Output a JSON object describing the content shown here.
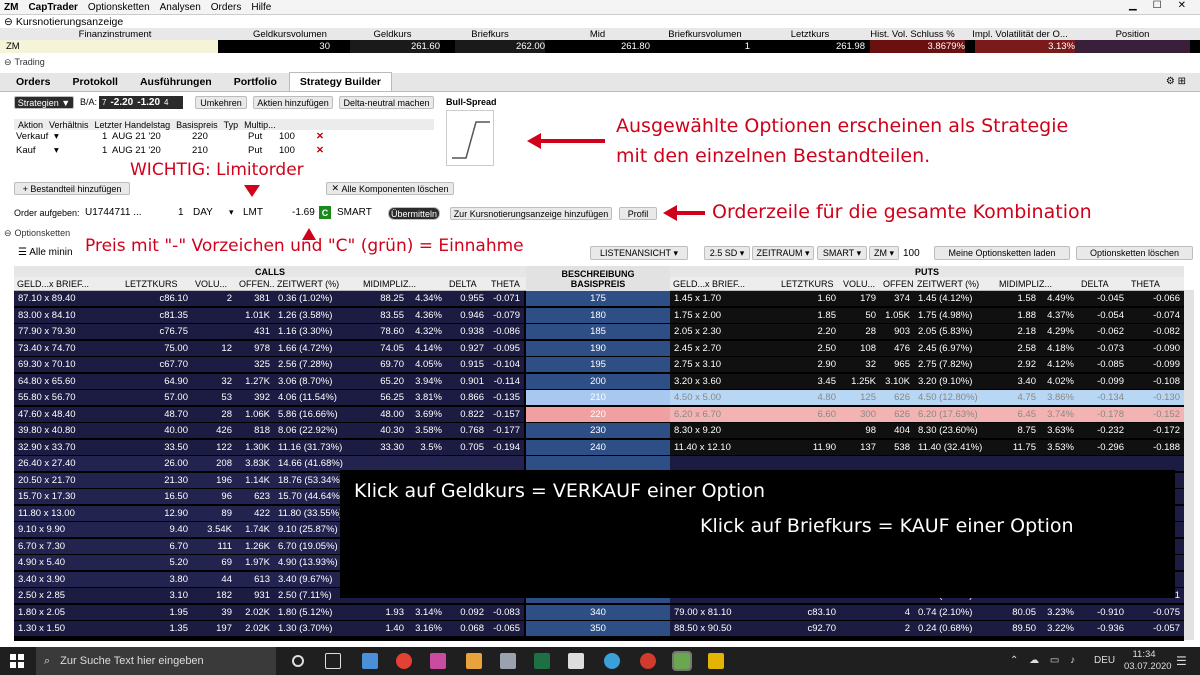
{
  "menubar": {
    "symbol": "ZM",
    "app": "CapTrader",
    "items": [
      "Optionsketten",
      "Analysen",
      "Orders",
      "Hilfe"
    ]
  },
  "kurs": {
    "title": "Kursnotierungsanzeige"
  },
  "quote": {
    "headers": [
      "Finanzinstrument",
      "Geldkursvolumen",
      "Geldkurs",
      "Briefkurs",
      "Mid",
      "Briefkursvolumen",
      "Letztkurs",
      "Hist. Vol. Schluss %",
      "Impl. Volatilität der O...",
      "Position"
    ],
    "values": [
      "ZM",
      "30",
      "261.60",
      "262.00",
      "261.80",
      "1",
      "261.98",
      "3.8679%",
      "3.13%",
      ""
    ]
  },
  "sections": {
    "trading": "Trading",
    "optionsketten": "Optionsketten"
  },
  "tabs": [
    "Orders",
    "Protokoll",
    "Ausführungen",
    "Portfolio",
    "Strategy Builder"
  ],
  "strategy": {
    "strategien": "Strategien",
    "ba_label": "B/A:",
    "ba_qty": "7",
    "bid": "-2.20",
    "ask": "-1.20",
    "ba_qty2": "4",
    "buttons": [
      "Umkehren",
      "Aktien hinzufügen",
      "Delta-neutral machen"
    ],
    "payoff_title": "Bull-Spread",
    "leg_headers": [
      "Aktion",
      "Verhältnis",
      "Letzter Handelstag",
      "Basispreis",
      "Typ",
      "Multip..."
    ],
    "legs": [
      {
        "aktion": "Verkauf",
        "ratio": "1",
        "expiry": "AUG 21 '20",
        "strike": "220",
        "typ": "Put",
        "mult": "100"
      },
      {
        "aktion": "Kauf",
        "ratio": "1",
        "expiry": "AUG 21 '20",
        "strike": "210",
        "typ": "Put",
        "mult": "100"
      }
    ],
    "add_leg": "Bestandteil hinzufügen",
    "clear_all": "Alle Komponenten löschen"
  },
  "order": {
    "label": "Order aufgeben:",
    "account": "U1744711 ...",
    "qty": "1",
    "tif": "DAY",
    "type": "LMT",
    "price": "-1.69",
    "c": "C",
    "exchange": "SMART",
    "btn_send": "Übermitteln",
    "btn_add": "Zur Kursnotierungsanzeige hinzufügen",
    "btn_profil": "Profil"
  },
  "chain_toolbar": {
    "alle": "Alle minin",
    "listview": "LISTENANSICHT",
    "sd": "2.5 SD",
    "zeitraum": "ZEITRAUM",
    "smart": "SMART",
    "zm": "ZM",
    "count": "100",
    "load": "Meine Optionsketten laden",
    "clear": "Optionsketten löschen"
  },
  "annotations": {
    "a1_line1": "Ausgewählte Optionen erscheinen als Strategie",
    "a1_line2": "mit den einzelnen Bestandteilen.",
    "wichtig": "WICHTIG: Limitorder",
    "a2": "Orderzeile für die gesamte Kombination",
    "preis": "Preis mit \"-\" Vorzeichen und \"C\" (grün) = Einnahme",
    "klick_geld": "Klick auf Geldkurs = VERKAUF einer Option",
    "klick_brief": "Klick auf Briefkurs = KAUF einer Option"
  },
  "table": {
    "calls_label": "CALLS",
    "puts_label": "PUTS",
    "strike_label_1": "BESCHREIBUNG",
    "strike_label_2": "BASISPREIS",
    "call_headers": [
      "GELD...x BRIEF...",
      "LETZTKURS",
      "VOLU...",
      "OFFEN...",
      "ZEITWERT (%)",
      "MIDIMPLIZ...",
      "DELTA",
      "THETA"
    ],
    "put_headers": [
      "GELD...x BRIEF...",
      "LETZTKURS",
      "VOLU...",
      "OFFEN...",
      "ZEITWERT (%)",
      "MIDIMPLIZ...",
      "DELTA",
      "THETA"
    ],
    "rows": [
      {
        "strike": "175",
        "c": [
          "87.10 x 89.40",
          "c86.10",
          "2",
          "381",
          "0.36 (1.02%)",
          "88.25",
          "4.34%",
          "0.955",
          "-0.071"
        ],
        "p": [
          "1.45 x 1.70",
          "1.60",
          "179",
          "374",
          "1.45 (4.12%)",
          "1.58",
          "4.49%",
          "-0.045",
          "-0.066"
        ]
      },
      {
        "strike": "180",
        "c": [
          "83.00 x 84.10",
          "c81.35",
          "",
          "1.01K",
          "1.26 (3.58%)",
          "83.55",
          "4.36%",
          "0.946",
          "-0.079"
        ],
        "p": [
          "1.75 x 2.00",
          "1.85",
          "50",
          "1.05K",
          "1.75 (4.98%)",
          "1.88",
          "4.37%",
          "-0.054",
          "-0.074"
        ]
      },
      {
        "strike": "185",
        "c": [
          "77.90 x 79.30",
          "c76.75",
          "",
          "431",
          "1.16 (3.30%)",
          "78.60",
          "4.32%",
          "0.938",
          "-0.086"
        ],
        "p": [
          "2.05 x 2.30",
          "2.20",
          "28",
          "903",
          "2.05 (5.83%)",
          "2.18",
          "4.29%",
          "-0.062",
          "-0.082"
        ]
      },
      {
        "strike": "190",
        "c": [
          "73.40 x 74.70",
          "75.00",
          "12",
          "978",
          "1.66 (4.72%)",
          "74.05",
          "4.14%",
          "0.927",
          "-0.095"
        ],
        "p": [
          "2.45 x 2.70",
          "2.50",
          "108",
          "476",
          "2.45 (6.97%)",
          "2.58",
          "4.18%",
          "-0.073",
          "-0.090"
        ]
      },
      {
        "strike": "195",
        "c": [
          "69.30 x 70.10",
          "c67.70",
          "",
          "325",
          "2.56 (7.28%)",
          "69.70",
          "4.05%",
          "0.915",
          "-0.104"
        ],
        "p": [
          "2.75 x 3.10",
          "2.90",
          "32",
          "965",
          "2.75 (7.82%)",
          "2.92",
          "4.12%",
          "-0.085",
          "-0.099"
        ]
      },
      {
        "strike": "200",
        "c": [
          "64.80 x 65.60",
          "64.90",
          "32",
          "1.27K",
          "3.06 (8.70%)",
          "65.20",
          "3.94%",
          "0.901",
          "-0.114"
        ],
        "p": [
          "3.20 x 3.60",
          "3.45",
          "1.25K",
          "3.10K",
          "3.20 (9.10%)",
          "3.40",
          "4.02%",
          "-0.099",
          "-0.108"
        ]
      },
      {
        "strike": "210",
        "c": [
          "55.80 x 56.70",
          "57.00",
          "53",
          "392",
          "4.06 (11.54%)",
          "56.25",
          "3.81%",
          "0.866",
          "-0.135"
        ],
        "p": [
          "4.50 x 5.00",
          "4.80",
          "125",
          "626",
          "4.50 (12.80%)",
          "4.75",
          "3.86%",
          "-0.134",
          "-0.130"
        ]
      },
      {
        "strike": "220",
        "c": [
          "47.60 x 48.40",
          "48.70",
          "28",
          "1.06K",
          "5.86 (16.66%)",
          "48.00",
          "3.69%",
          "0.822",
          "-0.157"
        ],
        "p": [
          "6.20 x 6.70",
          "6.60",
          "300",
          "626",
          "6.20 (17.63%)",
          "6.45",
          "3.74%",
          "-0.178",
          "-0.152"
        ]
      },
      {
        "strike": "230",
        "c": [
          "39.80 x 40.80",
          "40.00",
          "426",
          "818",
          "8.06 (22.92%)",
          "40.30",
          "3.58%",
          "0.768",
          "-0.177"
        ],
        "p": [
          "8.30 x 9.20",
          "",
          "98",
          "404",
          "8.30 (23.60%)",
          "8.75",
          "3.63%",
          "-0.232",
          "-0.172"
        ]
      },
      {
        "strike": "240",
        "c": [
          "32.90 x 33.70",
          "33.50",
          "122",
          "1.30K",
          "11.16 (31.73%)",
          "33.30",
          "3.5%",
          "0.705",
          "-0.194"
        ],
        "p": [
          "11.40 x 12.10",
          "11.90",
          "137",
          "538",
          "11.40 (32.41%)",
          "11.75",
          "3.53%",
          "-0.296",
          "-0.188"
        ]
      },
      {
        "strike": "",
        "c": [
          "26.40 x 27.40",
          "26.00",
          "208",
          "3.83K",
          "14.66 (41.68%)",
          "",
          "",
          "",
          ""
        ],
        "p": [
          "",
          "",
          "",
          "",
          "",
          "",
          "",
          "",
          ""
        ]
      },
      {
        "strike": "",
        "c": [
          "20.50 x 21.70",
          "21.30",
          "196",
          "1.14K",
          "18.76 (53.34%)",
          "",
          "",
          "",
          ""
        ],
        "p": [
          "",
          "",
          "",
          "",
          "",
          "",
          "",
          "",
          ""
        ]
      },
      {
        "strike": "",
        "c": [
          "15.70 x 17.30",
          "16.50",
          "96",
          "623",
          "15.70 (44.64%)",
          "",
          "",
          "",
          ""
        ],
        "p": [
          "",
          "",
          "",
          "",
          "",
          "",
          "",
          "",
          ""
        ]
      },
      {
        "strike": "",
        "c": [
          "11.80 x 13.00",
          "12.90",
          "89",
          "422",
          "11.80 (33.55%)",
          "",
          "",
          "",
          ""
        ],
        "p": [
          "",
          "",
          "",
          "",
          "",
          "",
          "",
          "",
          ""
        ]
      },
      {
        "strike": "",
        "c": [
          "9.10 x 9.90",
          "9.40",
          "3.54K",
          "1.74K",
          "9.10 (25.87%)",
          "",
          "",
          "",
          ""
        ],
        "p": [
          "",
          "",
          "",
          "",
          "",
          "",
          "",
          "",
          ""
        ]
      },
      {
        "strike": "",
        "c": [
          "6.70 x 7.30",
          "6.70",
          "111",
          "1.26K",
          "6.70 (19.05%)",
          "",
          "",
          "",
          ""
        ],
        "p": [
          "",
          "",
          "",
          "",
          "",
          "",
          "",
          "",
          ""
        ]
      },
      {
        "strike": "",
        "c": [
          "4.90 x 5.40",
          "5.20",
          "69",
          "1.97K",
          "4.90 (13.93%)",
          "",
          "",
          "",
          ""
        ],
        "p": [
          "",
          "",
          "",
          "",
          "",
          "",
          "",
          "",
          ""
        ]
      },
      {
        "strike": "",
        "c": [
          "3.40 x 3.90",
          "3.80",
          "44",
          "613",
          "3.40 (9.67%)",
          "",
          "",
          "",
          ""
        ],
        "p": [
          "",
          "",
          "",
          "",
          "",
          "",
          "",
          "",
          ""
        ]
      },
      {
        "strike": "330",
        "c": [
          "2.50 x 2.85",
          "3.10",
          "182",
          "931",
          "2.50 (7.11%)",
          "2.67",
          "3.13%",
          "0.120",
          "-0.099"
        ],
        "p": [
          "70.10 x 71.80",
          "c74.10",
          "",
          "6",
          "1.84 (5.23%)",
          "70.95",
          "3.21%",
          "-0.882",
          "-0.091"
        ]
      },
      {
        "strike": "340",
        "c": [
          "1.80 x 2.05",
          "1.95",
          "39",
          "2.02K",
          "1.80 (5.12%)",
          "1.93",
          "3.14%",
          "0.092",
          "-0.083"
        ],
        "p": [
          "79.00 x 81.10",
          "c83.10",
          "",
          "4",
          "0.74 (2.10%)",
          "80.05",
          "3.23%",
          "-0.910",
          "-0.075"
        ]
      },
      {
        "strike": "350",
        "c": [
          "1.30 x 1.50",
          "1.35",
          "197",
          "2.02K",
          "1.30 (3.70%)",
          "1.40",
          "3.16%",
          "0.068",
          "-0.065"
        ],
        "p": [
          "88.50 x 90.50",
          "c92.70",
          "",
          "2",
          "0.24 (0.68%)",
          "89.50",
          "3.22%",
          "-0.936",
          "-0.057"
        ]
      }
    ]
  },
  "taskbar": {
    "search": "Zur Suche Text hier eingeben",
    "lang": "DEU",
    "time": "11:34",
    "date": "03.07.2020"
  }
}
